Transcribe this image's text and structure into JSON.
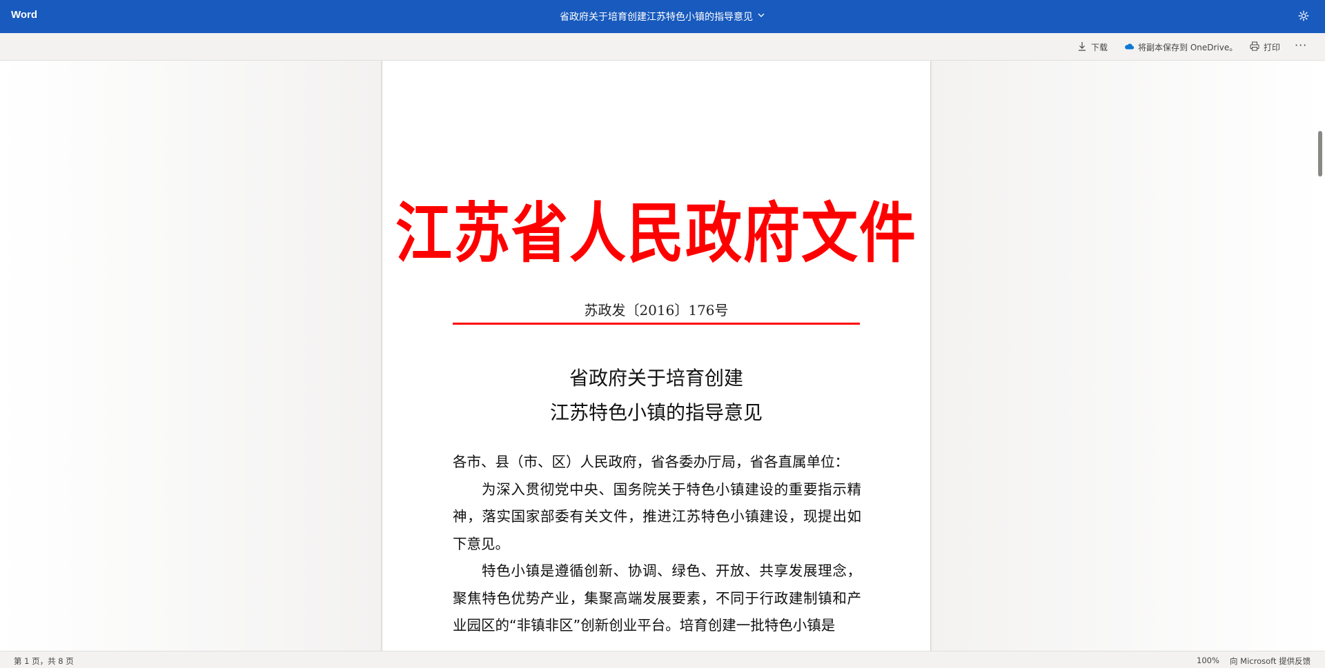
{
  "titlebar": {
    "app_name": "Word",
    "document_title": "省政府关于培育创建江苏特色小镇的指导意见",
    "accent_color": "#185abd"
  },
  "toolbar": {
    "download_label": "下载",
    "onedrive_label": "将副本保存到 OneDrive。",
    "print_label": "打印",
    "more_label": "···"
  },
  "document": {
    "header": "江苏省人民政府文件",
    "header_color": "#ff0000",
    "number": "苏政发〔2016〕176号",
    "title_line1": "省政府关于培育创建",
    "title_line2": "江苏特色小镇的指导意见",
    "salutation": "各市、县（市、区）人民政府，省各委办厅局，省各直属单位：",
    "paragraph1": "为深入贯彻党中央、国务院关于特色小镇建设的重要指示精神，落实国家部委有关文件，推进江苏特色小镇建设，现提出如下意见。",
    "paragraph2": "特色小镇是遵循创新、协调、绿色、开放、共享发展理念，聚焦特色优势产业，集聚高端发展要素，不同于行政建制镇和产业园区的“非镇非区”创新创业平台。培育创建一批特色小镇是"
  },
  "statusbar": {
    "page_count": "第 1 页，共 8 页",
    "zoom": "100%",
    "feedback": "向 Microsoft 提供反馈"
  }
}
